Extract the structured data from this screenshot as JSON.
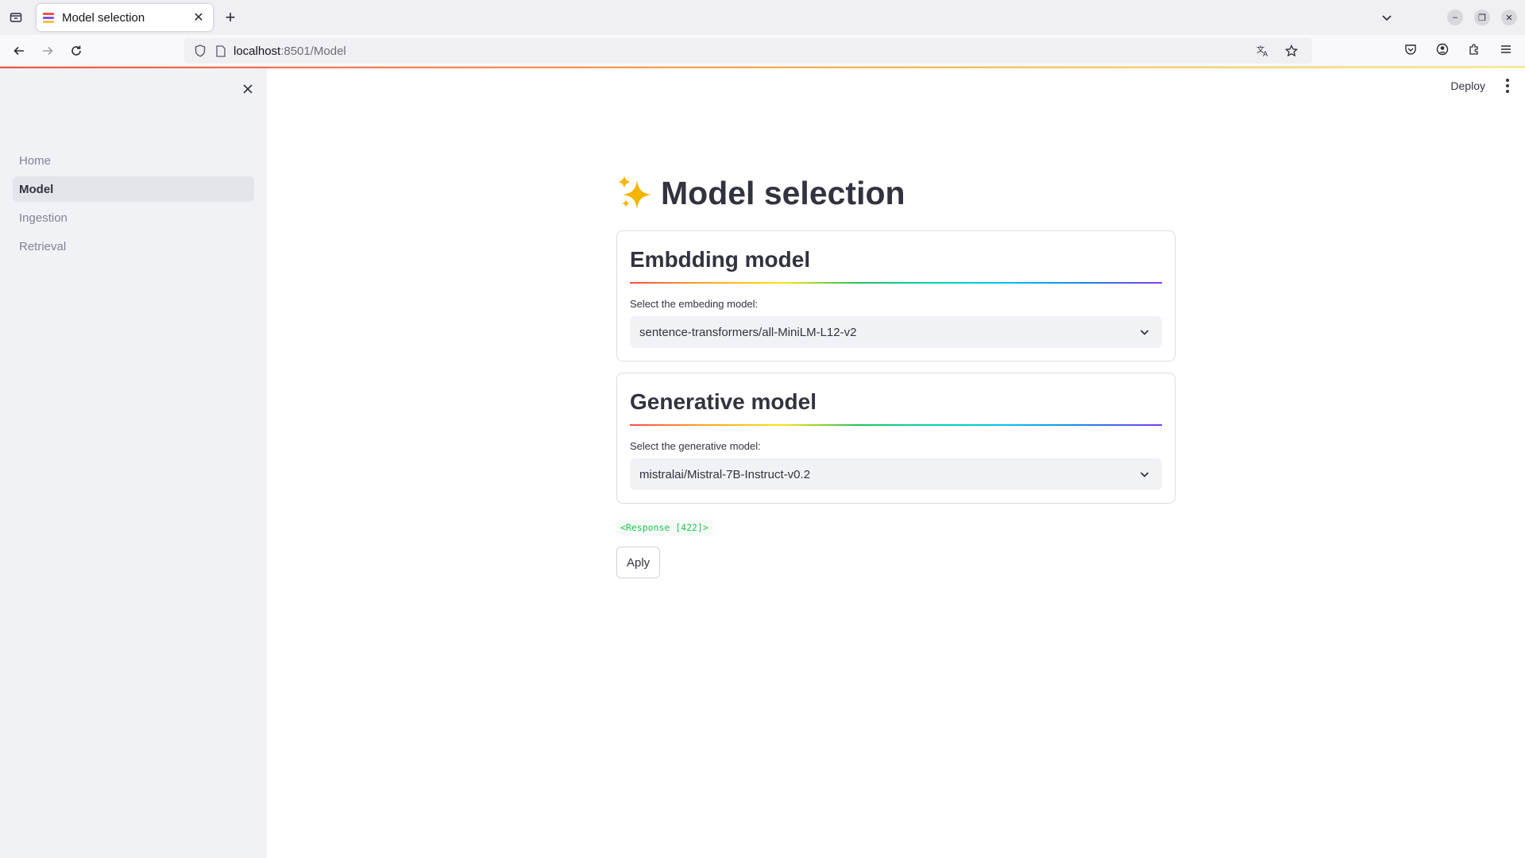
{
  "browser": {
    "tab_title": "Model selection",
    "url_host": "localhost",
    "url_rest": ":8501/Model"
  },
  "sidebar": {
    "items": [
      {
        "label": "Home",
        "active": false
      },
      {
        "label": "Model",
        "active": true
      },
      {
        "label": "Ingestion",
        "active": false
      },
      {
        "label": "Retrieval",
        "active": false
      }
    ]
  },
  "header": {
    "deploy_label": "Deploy"
  },
  "main": {
    "title": "Model selection",
    "embedding": {
      "heading": "Embdding model",
      "label": "Select the embeding model:",
      "value": "sentence-transformers/all-MiniLM-L12-v2"
    },
    "generative": {
      "heading": "Generative model",
      "label": "Select the generative model:",
      "value": "mistralai/Mistral-7B-Instruct-v0.2"
    },
    "response_text": "<Response [422]>",
    "apply_label": "Aply"
  },
  "icons": {
    "tab_list": "tab-list-icon",
    "title_icon": "sparkles-icon",
    "sidebar_close": "close-icon",
    "select_chevron": "chevron-down-icon"
  },
  "colors": {
    "accent_red": "#ff4b4b",
    "sparkle": "#f4b400",
    "response_green": "#21c354",
    "sidebar_bg": "#f0f2f6"
  }
}
